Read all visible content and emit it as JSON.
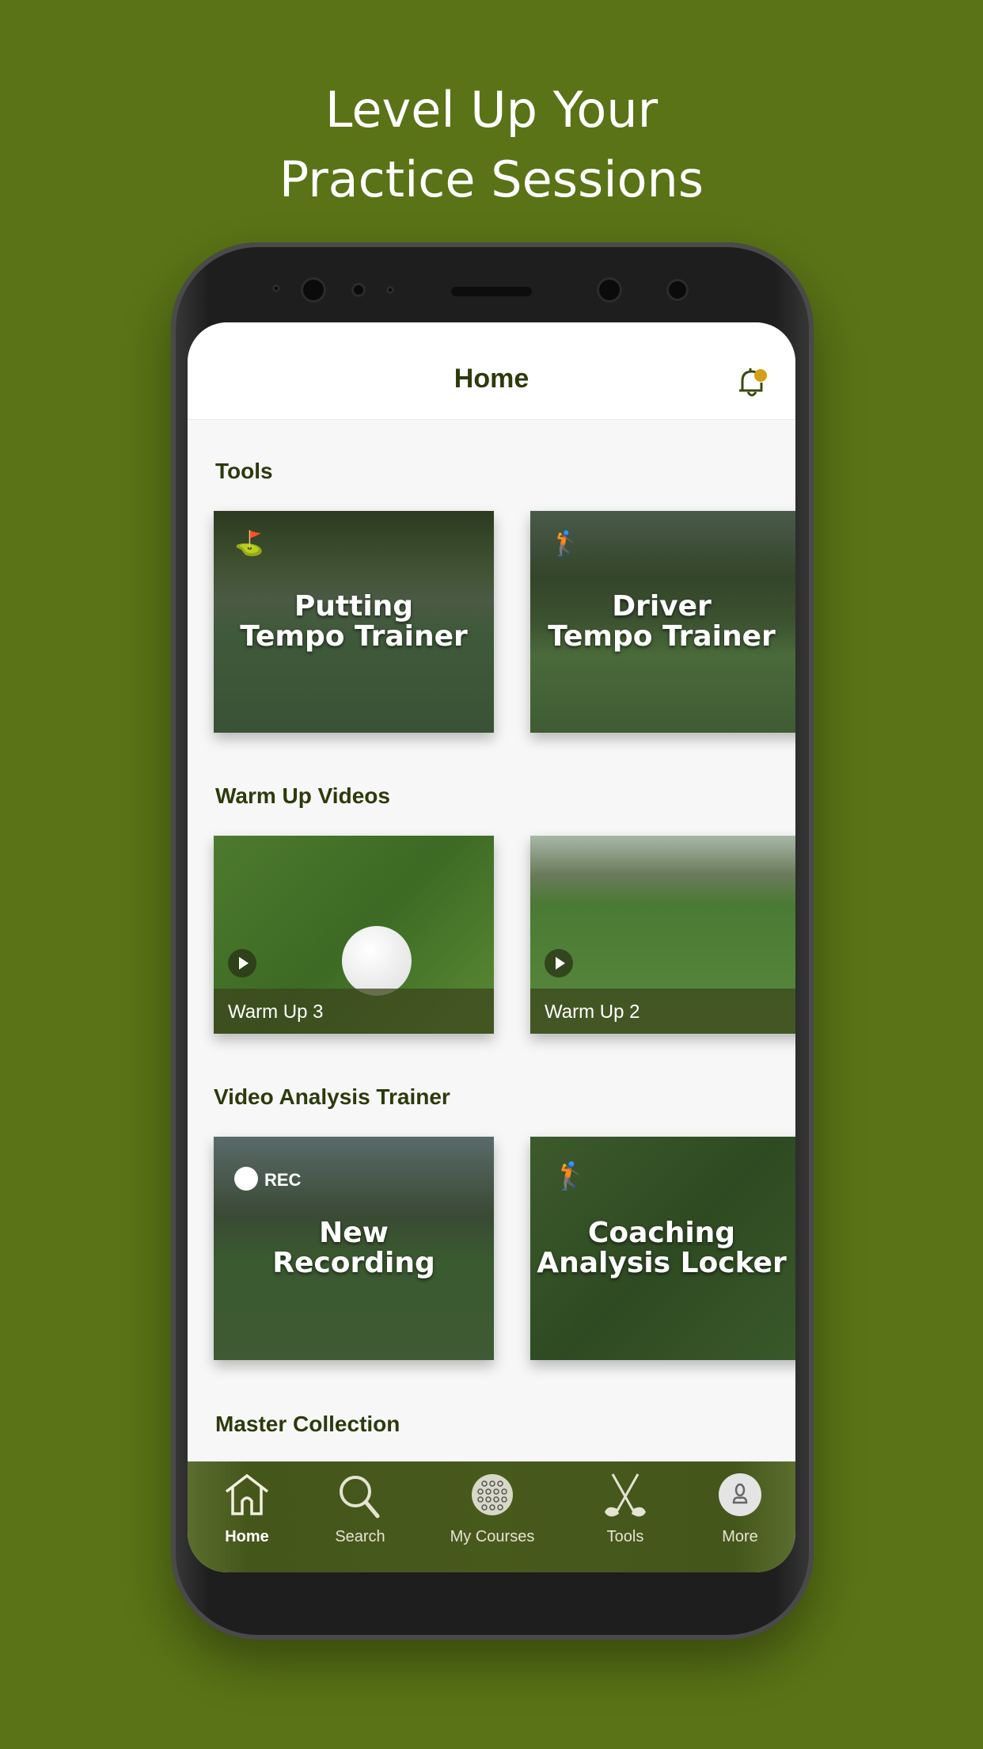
{
  "headline": {
    "line1": "Level Up Your",
    "line2": "Practice Sessions"
  },
  "header": {
    "title": "Home",
    "notification_icon": "bell-icon",
    "badge_color": "#d4a017"
  },
  "sections": [
    {
      "title": "Tools",
      "cards": [
        {
          "line1": "Putting",
          "line2": "Tempo Trainer",
          "icon": "putting-golfer-icon"
        },
        {
          "line1": "Driver",
          "line2": "Tempo Trainer",
          "icon": "swinging-golfer-icon"
        }
      ]
    },
    {
      "title": "Warm Up Videos",
      "cards": [
        {
          "caption": "Warm Up 3",
          "icon": "play-icon"
        },
        {
          "caption": "Warm Up 2",
          "icon": "play-icon"
        }
      ]
    },
    {
      "title": "Video Analysis Trainer",
      "cards": [
        {
          "line1": "New",
          "line2": "Recording",
          "badge": "REC",
          "icon": "record-icon"
        },
        {
          "line1": "Coaching",
          "line2": "Analysis Locker",
          "icon": "golf-bag-icon"
        }
      ]
    },
    {
      "title": "Master Collection"
    }
  ],
  "tabbar": {
    "items": [
      {
        "label": "Home",
        "icon": "home-icon",
        "active": true
      },
      {
        "label": "Search",
        "icon": "search-icon"
      },
      {
        "label": "My Courses",
        "icon": "golf-ball-icon"
      },
      {
        "label": "Tools",
        "icon": "golf-clubs-icon"
      },
      {
        "label": "More",
        "icon": "user-icon"
      }
    ]
  },
  "colors": {
    "background": "#597316",
    "accent": "#2d3a0c",
    "tabbar": "#48591c"
  }
}
